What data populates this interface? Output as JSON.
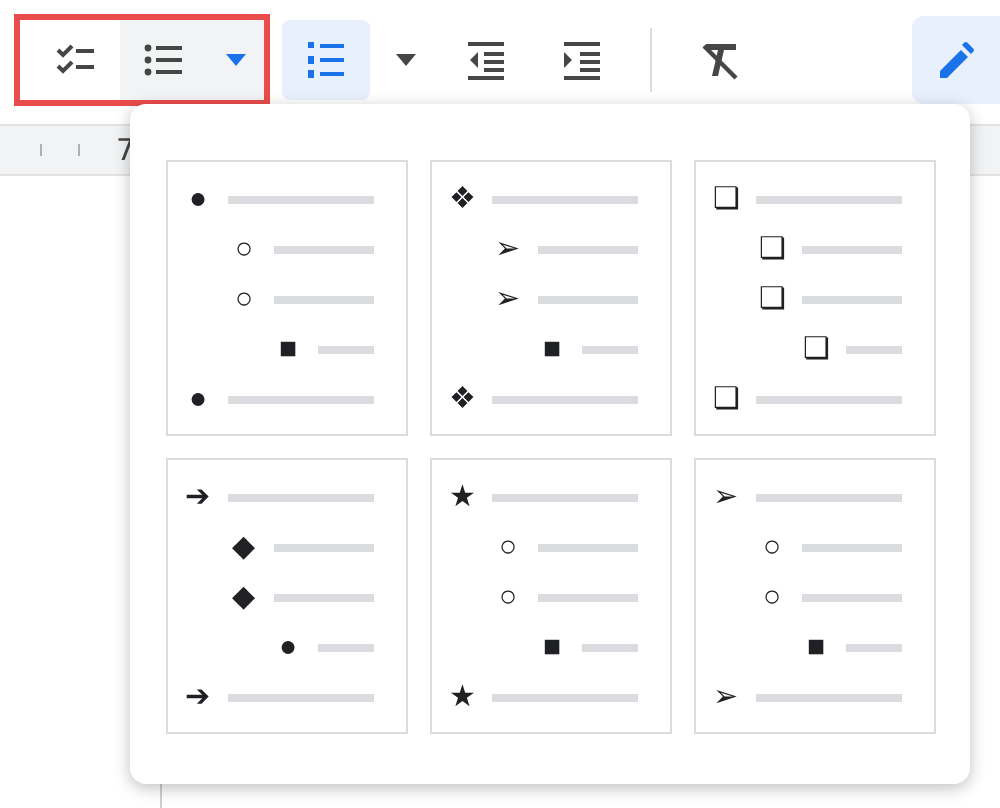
{
  "toolbar": {
    "highlighted_items": [
      {
        "kind": "checklist"
      },
      {
        "kind": "bulleted",
        "selected": false,
        "open": true
      }
    ],
    "items": [
      {
        "kind": "numbered",
        "selected": true,
        "open": false
      },
      {
        "kind": "outdent",
        "selected": false,
        "open": false
      },
      {
        "kind": "indent",
        "selected": false,
        "open": false
      },
      {
        "kind": "clear-format",
        "selected": false,
        "open": false
      }
    ],
    "edit_button": {
      "selected": true
    }
  },
  "ruler": {
    "label": "7"
  },
  "bullet_menu": {
    "presets": [
      {
        "items": [
          {
            "bullet": "●",
            "children": [
              {
                "bullet": "○"
              },
              {
                "bullet": "○",
                "children": [
                  {
                    "bullet": "■"
                  }
                ]
              }
            ]
          },
          {
            "bullet": "●"
          }
        ]
      },
      {
        "items": [
          {
            "bullet": "❖",
            "children": [
              {
                "bullet": "➢"
              },
              {
                "bullet": "➢",
                "children": [
                  {
                    "bullet": "■"
                  }
                ]
              }
            ]
          },
          {
            "bullet": "❖"
          }
        ]
      },
      {
        "items": [
          {
            "bullet": "❏",
            "children": [
              {
                "bullet": "❏"
              },
              {
                "bullet": "❏",
                "children": [
                  {
                    "bullet": "❏"
                  }
                ]
              }
            ]
          },
          {
            "bullet": "❏"
          }
        ]
      },
      {
        "items": [
          {
            "bullet": "➔",
            "children": [
              {
                "bullet": "◆"
              },
              {
                "bullet": "◆",
                "children": [
                  {
                    "bullet": "●"
                  }
                ]
              }
            ]
          },
          {
            "bullet": "➔"
          }
        ]
      },
      {
        "items": [
          {
            "bullet": "★",
            "children": [
              {
                "bullet": "○"
              },
              {
                "bullet": "○",
                "children": [
                  {
                    "bullet": "■"
                  }
                ]
              }
            ]
          },
          {
            "bullet": "★"
          }
        ]
      },
      {
        "items": [
          {
            "bullet": "➢",
            "children": [
              {
                "bullet": "○"
              },
              {
                "bullet": "○",
                "children": [
                  {
                    "bullet": "■"
                  }
                ]
              }
            ]
          },
          {
            "bullet": "➢"
          }
        ]
      }
    ]
  }
}
